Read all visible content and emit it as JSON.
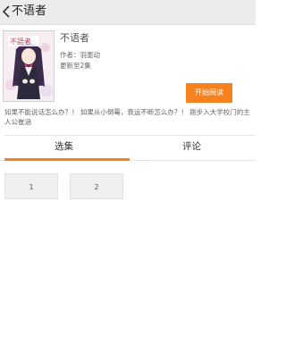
{
  "header": {
    "title": "不语者"
  },
  "book": {
    "title": "不语者",
    "author_label": "作者：羽墨动",
    "update_label": "更新至2集",
    "read_button_label": "开始阅读",
    "description": "如果不能说话怎么办？！ 如果从小倒霉，衰运不断怎么办？！ 刚步入大学校门的主人公崔涵",
    "cover_text": "不語者"
  },
  "tabs": [
    {
      "label": "选集",
      "active": true
    },
    {
      "label": "评论",
      "active": false
    }
  ],
  "episodes": [
    {
      "label": "1"
    },
    {
      "label": "2"
    }
  ],
  "colors": {
    "accent": "#f5821f",
    "header_bg": "#ececec"
  }
}
